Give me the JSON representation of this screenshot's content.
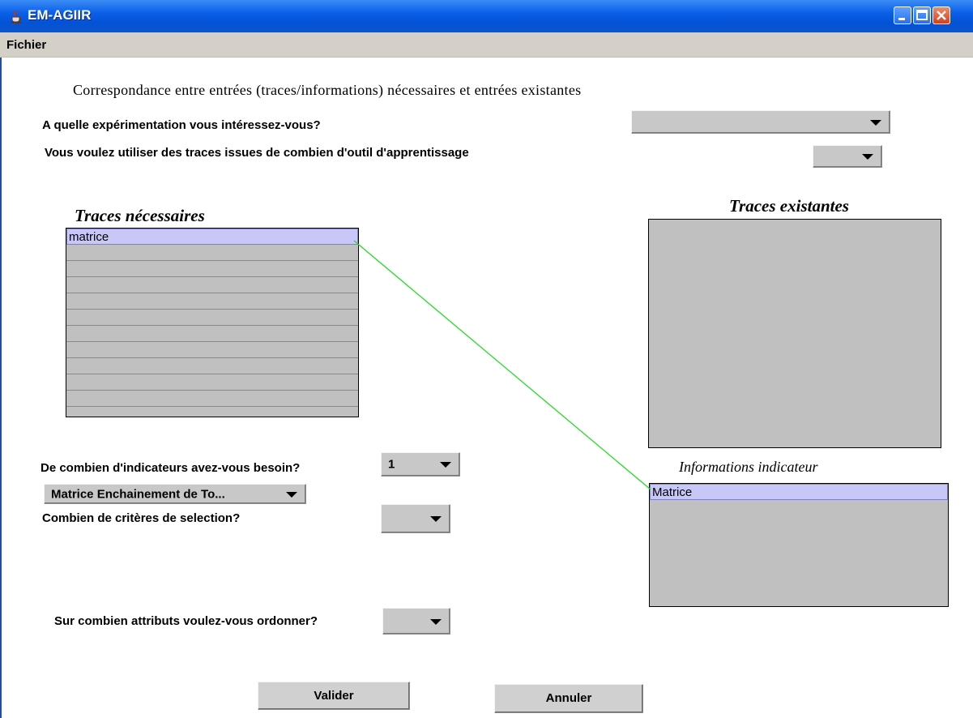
{
  "window": {
    "title": "EM-AGIIR"
  },
  "menu": {
    "items": [
      "Fichier"
    ]
  },
  "heading": "Correspondance entre entrées (traces/informations) nécessaires et entrées existantes",
  "questions": {
    "experimentation": "A quelle expérimentation vous intéressez-vous?",
    "outils": "Vous voulez utiliser des traces issues de combien d'outil d'apprentissage",
    "indicateurs": "De combien d'indicateurs avez-vous besoin?",
    "criteres": "Combien de critères de selection?",
    "attributs": "Sur combien attributs voulez-vous ordonner?"
  },
  "combos": {
    "experimentation": "",
    "outils": "",
    "indicateurs": "1",
    "indicateur_type": "Matrice Enchainement de To...",
    "criteres": "",
    "attributs": ""
  },
  "panels": {
    "traces_necessaires": {
      "title": "Traces nécessaires",
      "items": [
        "matrice"
      ]
    },
    "traces_existantes": {
      "title": "Traces existantes",
      "items": []
    },
    "informations_indicateur": {
      "title": "Informations indicateur",
      "items": [
        "Matrice"
      ]
    }
  },
  "buttons": {
    "valider": "Valider",
    "annuler": "Annuler"
  },
  "colors": {
    "titlebar": "#0452d6",
    "connector": "#22dd22",
    "selection": "#c8c8f8",
    "panel": "#c0c0c0"
  }
}
